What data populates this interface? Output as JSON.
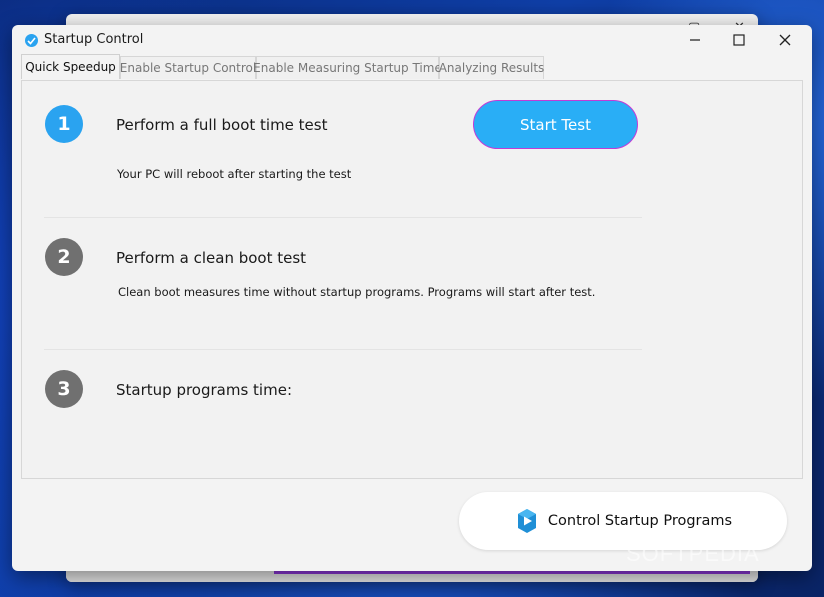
{
  "colors": {
    "accent_blue": "#29aef6",
    "step_active": "#2aa3f0",
    "step_inactive": "#707070",
    "button_border": "#c23bd6"
  },
  "window": {
    "title": "Startup Control",
    "icon": "app-icon"
  },
  "tabs": [
    {
      "label": "Quick Speedup",
      "active": true
    },
    {
      "label": "Enable Startup Control",
      "active": false
    },
    {
      "label": "Enable Measuring Startup Time",
      "active": false
    },
    {
      "label": "Analyzing Results",
      "active": false
    }
  ],
  "steps": [
    {
      "number": "1",
      "title": "Perform a full boot time test",
      "description": "Your PC will reboot after starting the test",
      "state": "active"
    },
    {
      "number": "2",
      "title": "Perform a clean boot test",
      "description": "Clean boot measures time without startup programs. Programs will start after test.",
      "state": "inactive"
    },
    {
      "number": "3",
      "title": "Startup programs time:",
      "description": "",
      "state": "inactive"
    }
  ],
  "start_button": {
    "label": "Start Test"
  },
  "control_button": {
    "label": "Control Startup Programs",
    "icon": "play-icon"
  },
  "watermark": {
    "text": "SOFTPEDIA"
  }
}
